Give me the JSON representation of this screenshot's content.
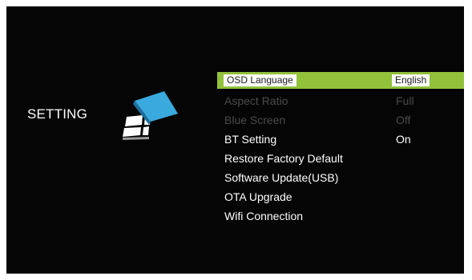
{
  "screen": {
    "title": "SETTING",
    "icon": "setting-logo-icon"
  },
  "menu": {
    "items": [
      {
        "label": "OSD Language",
        "value": "English",
        "state": "selected"
      },
      {
        "label": "Aspect Ratio",
        "value": "Full",
        "state": "disabled"
      },
      {
        "label": "Blue Screen",
        "value": "Off",
        "state": "disabled"
      },
      {
        "label": "BT Setting",
        "value": "On",
        "state": "normal"
      },
      {
        "label": "Restore Factory Default",
        "value": "",
        "state": "normal"
      },
      {
        "label": "Software Update(USB)",
        "value": "",
        "state": "normal"
      },
      {
        "label": "OTA Upgrade",
        "value": "",
        "state": "normal"
      },
      {
        "label": "Wifi Connection",
        "value": "",
        "state": "normal"
      }
    ]
  },
  "colors": {
    "background": "#050505",
    "highlight": "#92c13b",
    "text": "#ffffff",
    "disabled_text": "#4b4b4b"
  }
}
